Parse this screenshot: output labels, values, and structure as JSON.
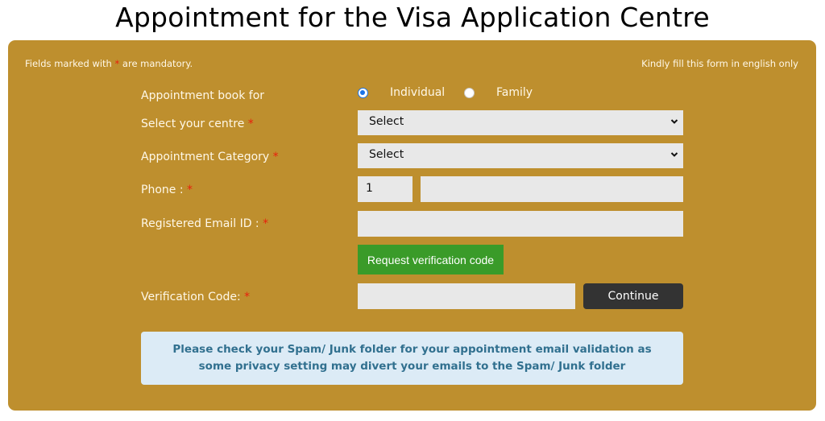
{
  "page": {
    "title": "Appointment for the Visa Application Centre"
  },
  "notes": {
    "mandatory_prefix": "Fields marked with ",
    "mandatory_star": "*",
    "mandatory_suffix": " are mandatory.",
    "english_only": "Kindly fill this form in english only"
  },
  "form": {
    "book_for": {
      "label": "Appointment book for",
      "options": [
        {
          "label": "Individual",
          "checked": true
        },
        {
          "label": "Family",
          "checked": false
        }
      ]
    },
    "centre": {
      "label": "Select your centre",
      "required": "*",
      "selected": "Select"
    },
    "category": {
      "label": "Appointment Category",
      "required": "*",
      "selected": "Select"
    },
    "phone": {
      "label": "Phone :",
      "required": "*",
      "country_code": "1",
      "number": ""
    },
    "email": {
      "label": "Registered Email ID :",
      "required": "*",
      "value": ""
    },
    "request_code_button": "Request verification code",
    "verification": {
      "label": "Verification Code:",
      "required": "*",
      "value": ""
    },
    "continue_button": "Continue"
  },
  "info_message": {
    "line1": "Please check your Spam/ Junk folder for your appointment email validation as",
    "line2": "some privacy setting may divert your emails to the Spam/ Junk folder"
  },
  "colors": {
    "panel": "#be8f2e",
    "required": "#e8200c",
    "primary_button": "#3a9b29",
    "continue_button": "#333333",
    "info_background": "#dcebf6",
    "info_text": "#31708f"
  }
}
